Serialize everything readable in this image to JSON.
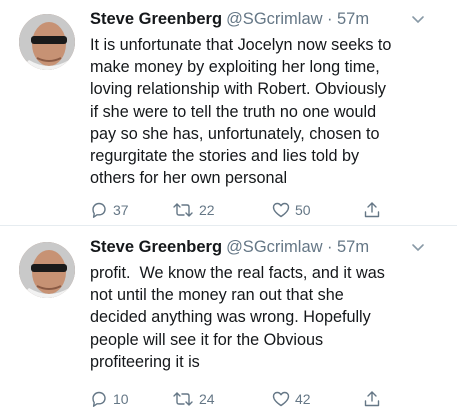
{
  "tweets": [
    {
      "author_name": "Steve Greenberg",
      "handle": "@SGcrimlaw",
      "separator": "·",
      "time": "57m",
      "text": "It is unfortunate that Jocelyn now seeks to\nmake money by exploiting her long time,\nloving relationship with Robert. Obviously\nif she were to tell the truth no one would\npay so she has, unfortunately, chosen to\nregurgitate the stories and lies told by\nothers for her own personal",
      "replies": "37",
      "retweets": "22",
      "likes": "50"
    },
    {
      "author_name": "Steve Greenberg",
      "handle": "@SGcrimlaw",
      "separator": "·",
      "time": "57m",
      "text": "profit.  We know the real facts, and it was\nnot until the money ran out that she\ndecided anything was wrong. Hopefully\npeople will see it for the Obvious\nprofiteering it is",
      "replies": "10",
      "retweets": "24",
      "likes": "42"
    }
  ],
  "icons": {
    "reply": "reply-icon",
    "retweet": "retweet-icon",
    "like": "heart-icon",
    "share": "share-icon",
    "more": "chevron-down-icon"
  },
  "colors": {
    "text": "#14171a",
    "secondary": "#657786",
    "divider": "#e6ecf0"
  }
}
